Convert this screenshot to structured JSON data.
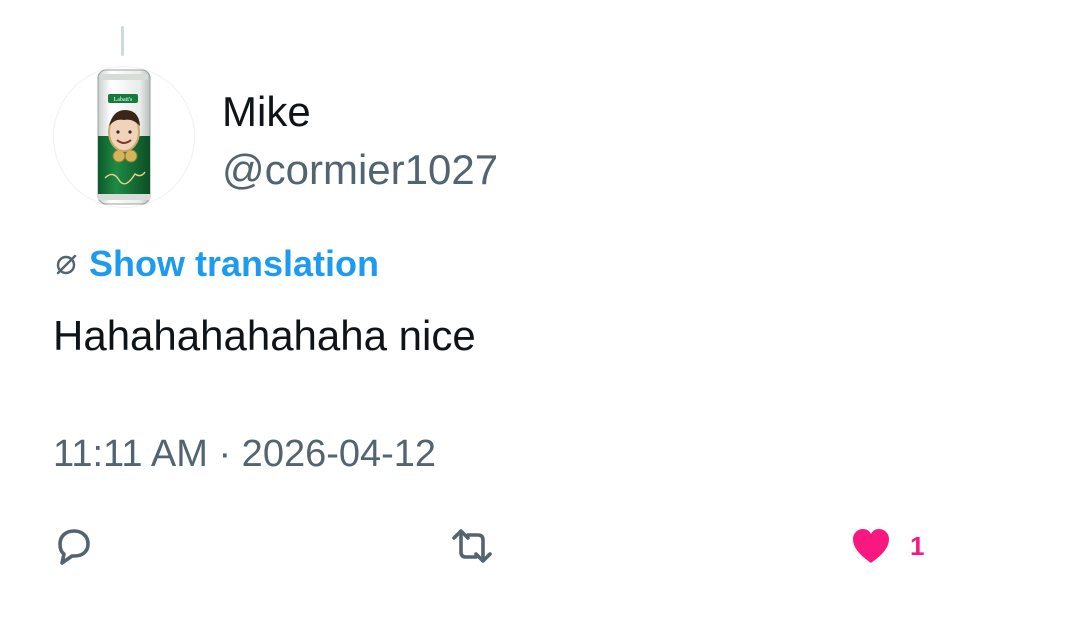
{
  "tweet": {
    "author": {
      "display_name": "Mike",
      "handle": "@cormier1027",
      "avatar": "beer-can-avatar"
    },
    "translate_label": "Show translation",
    "text": "Hahahahahahaha nice",
    "timestamp": "11:11 AM · 2026-04-12",
    "actions": {
      "reply_icon": "reply-icon",
      "retweet_icon": "retweet-icon",
      "like_icon": "heart-filled-icon",
      "like_count": "1"
    }
  },
  "colors": {
    "text_primary": "#0f1419",
    "text_secondary": "#536471",
    "link": "#1d9bf0",
    "like": "#f91880"
  }
}
